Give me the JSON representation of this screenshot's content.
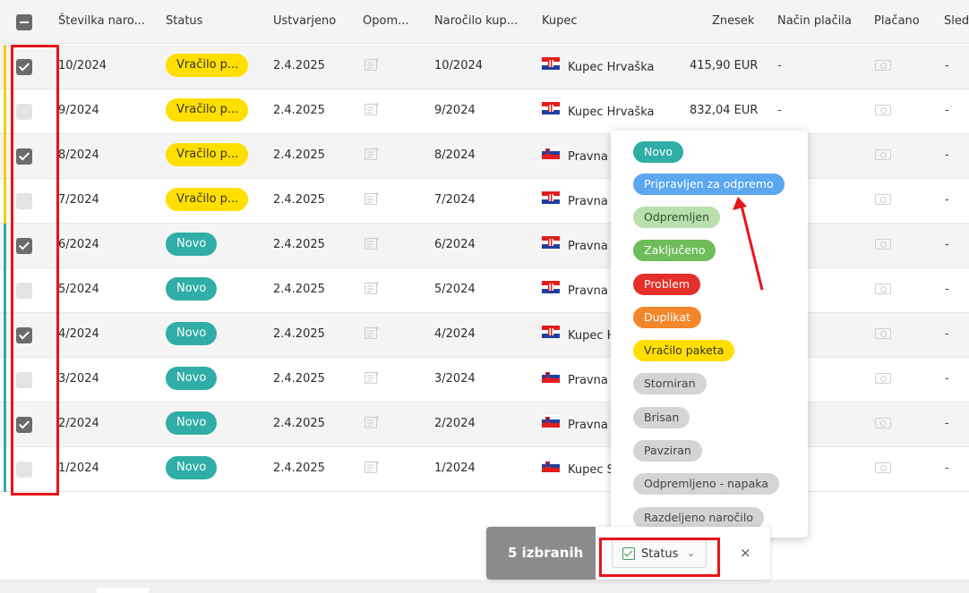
{
  "columns": [
    "Številka naro...",
    "Status",
    "Ustvarjeno",
    "Opom...",
    "Naročilo kup...",
    "Kupec",
    "Znesek",
    "Način plačila",
    "Plačano",
    "Sled"
  ],
  "rows": [
    {
      "num": "10/2024",
      "status": "Vračilo p...",
      "status_type": "yellow",
      "created": "2.4.2025",
      "order": "10/2024",
      "flag": "hr",
      "buyer": "Kupec Hrvaška",
      "amount": "415,90 EUR",
      "payment": "-",
      "track": "-",
      "checked": true,
      "bar": "#f5cd00"
    },
    {
      "num": "9/2024",
      "status": "Vračilo p...",
      "status_type": "yellow",
      "created": "2.4.2025",
      "order": "9/2024",
      "flag": "hr",
      "buyer": "Kupec Hrvaška",
      "amount": "832,04 EUR",
      "payment": "-",
      "track": "-",
      "checked": false,
      "bar": "#f5cd00"
    },
    {
      "num": "8/2024",
      "status": "Vračilo p...",
      "status_type": "yellow",
      "created": "2.4.2025",
      "order": "8/2024",
      "flag": "si",
      "buyer": "Pravna o",
      "amount": "",
      "payment": "",
      "track": "-",
      "checked": true,
      "bar": "#f5cd00"
    },
    {
      "num": "7/2024",
      "status": "Vračilo p...",
      "status_type": "yellow",
      "created": "2.4.2025",
      "order": "7/2024",
      "flag": "hr",
      "buyer": "Pravna o",
      "amount": "",
      "payment": "",
      "track": "-",
      "checked": false,
      "bar": "#f5cd00"
    },
    {
      "num": "6/2024",
      "status": "Novo",
      "status_type": "teal",
      "created": "2.4.2025",
      "order": "6/2024",
      "flag": "hr",
      "buyer": "Pravna o",
      "amount": "",
      "payment": "",
      "track": "-",
      "checked": true,
      "bar": "#2fada6"
    },
    {
      "num": "5/2024",
      "status": "Novo",
      "status_type": "teal",
      "created": "2.4.2025",
      "order": "5/2024",
      "flag": "hr",
      "buyer": "Pravna o",
      "amount": "",
      "payment": "",
      "track": "-",
      "checked": false,
      "bar": "#2fada6"
    },
    {
      "num": "4/2024",
      "status": "Novo",
      "status_type": "teal",
      "created": "2.4.2025",
      "order": "4/2024",
      "flag": "hr",
      "buyer": "Kupec H",
      "amount": "",
      "payment": "",
      "track": "-",
      "checked": true,
      "bar": "#2fada6"
    },
    {
      "num": "3/2024",
      "status": "Novo",
      "status_type": "teal",
      "created": "2.4.2025",
      "order": "3/2024",
      "flag": "si",
      "buyer": "Pravna o",
      "amount": "",
      "payment": "",
      "track": "-",
      "checked": false,
      "bar": "#2fada6"
    },
    {
      "num": "2/2024",
      "status": "Novo",
      "status_type": "teal",
      "created": "2.4.2025",
      "order": "2/2024",
      "flag": "si",
      "buyer": "Pravna o",
      "amount": "",
      "payment": "",
      "track": "-",
      "checked": true,
      "bar": "#2fada6"
    },
    {
      "num": "1/2024",
      "status": "Novo",
      "status_type": "teal",
      "created": "2.4.2025",
      "order": "1/2024",
      "flag": "si",
      "buyer": "Kupec S",
      "amount": "",
      "payment": "",
      "track": "-",
      "checked": false,
      "bar": "#2fada6"
    }
  ],
  "status_menu": [
    {
      "label": "Novo",
      "bg": "#2fada6",
      "fg": "#ffffff"
    },
    {
      "label": "Pripravljen za odpremo",
      "bg": "#5ba7f0",
      "fg": "#ffffff"
    },
    {
      "label": "Odpremljen",
      "bg": "#b9dfae",
      "fg": "#2f4f2a"
    },
    {
      "label": "Zaključeno",
      "bg": "#6ebc5a",
      "fg": "#ffffff"
    },
    {
      "label": "Problem",
      "bg": "#e5302a",
      "fg": "#ffffff"
    },
    {
      "label": "Duplikat",
      "bg": "#f3862a",
      "fg": "#ffffff"
    },
    {
      "label": "Vračilo paketa",
      "bg": "#ffde00",
      "fg": "#333333"
    },
    {
      "label": "Storniran",
      "bg": "#d4d4d6",
      "fg": "#444444"
    },
    {
      "label": "Brisan",
      "bg": "#d4d4d6",
      "fg": "#444444"
    },
    {
      "label": "Pavziran",
      "bg": "#d4d4d6",
      "fg": "#444444"
    },
    {
      "label": "Odpremljeno - napaka",
      "bg": "#d4d4d6",
      "fg": "#444444"
    },
    {
      "label": "Razdeljeno naročilo",
      "bg": "#d4d4d6",
      "fg": "#444444"
    }
  ],
  "bulk": {
    "count_label": "5 izbranih",
    "status_label": "Status",
    "close": "×"
  }
}
